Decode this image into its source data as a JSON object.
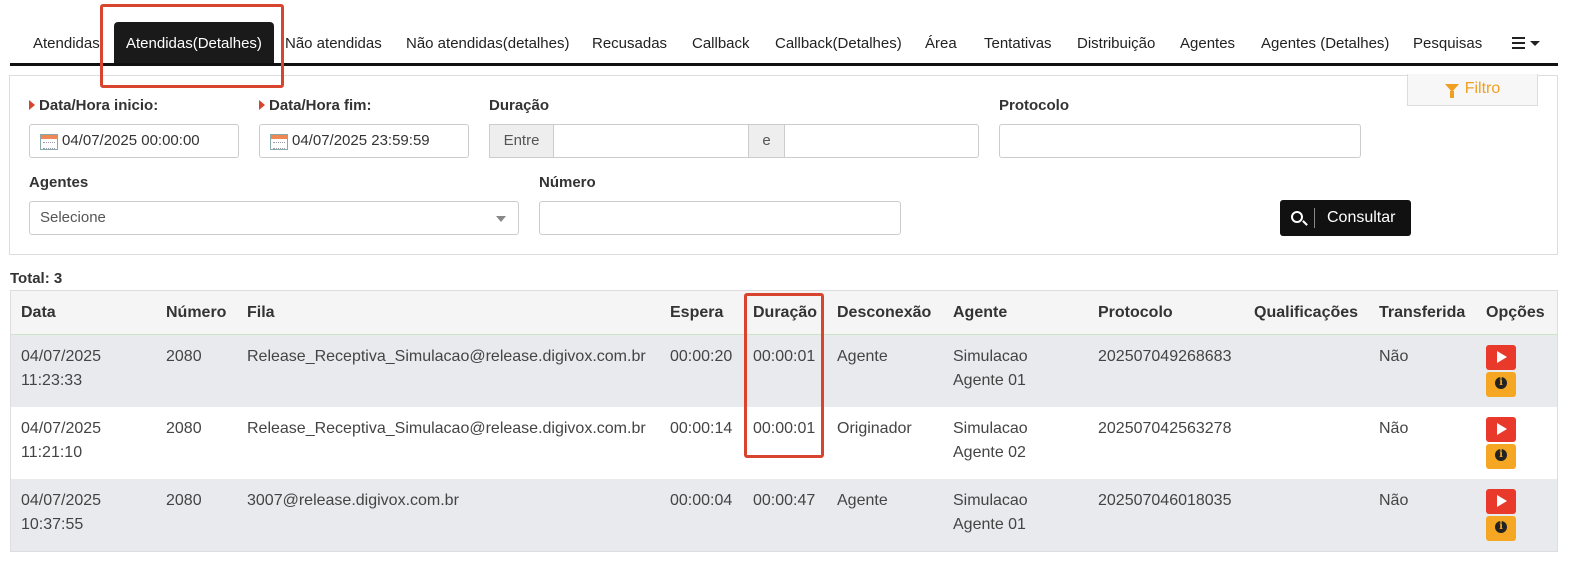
{
  "tabs": [
    {
      "label": "Atendidas"
    },
    {
      "label": "Atendidas(Detalhes)"
    },
    {
      "label": "Não atendidas"
    },
    {
      "label": "Não atendidas(detalhes)"
    },
    {
      "label": "Recusadas"
    },
    {
      "label": "Callback"
    },
    {
      "label": "Callback(Detalhes)"
    },
    {
      "label": "Área"
    },
    {
      "label": "Tentativas"
    },
    {
      "label": "Distribuição"
    },
    {
      "label": "Agentes"
    },
    {
      "label": "Agentes (Detalhes)"
    },
    {
      "label": "Pesquisas"
    }
  ],
  "active_tab": "Atendidas(Detalhes)",
  "filter": {
    "toggle_label": "Filtro",
    "start_label": "Data/Hora inicio:",
    "start_value": "04/07/2025 00:00:00",
    "end_label": "Data/Hora fim:",
    "end_value": "04/07/2025 23:59:59",
    "duration_label": "Duração",
    "duration_between": "Entre",
    "duration_and": "e",
    "duration_from": "",
    "duration_to": "",
    "protocol_label": "Protocolo",
    "protocol_value": "",
    "agents_label": "Agentes",
    "agents_selected": "Selecione",
    "number_label": "Número",
    "number_value": "",
    "submit_label": "Consultar"
  },
  "total_label": "Total: 3",
  "table": {
    "headers": [
      "Data",
      "Número",
      "Fila",
      "Espera",
      "Duração",
      "Desconexão",
      "Agente",
      "Protocolo",
      "Qualificações",
      "Transferida",
      "Opções"
    ],
    "rows": [
      {
        "date": "04/07/2025",
        "time": "11:23:33",
        "number": "2080",
        "queue": "Release_Receptiva_Simulacao@release.digivox.com.br",
        "wait": "00:00:20",
        "duration": "00:00:01",
        "disconnect": "Agente",
        "agent_line1": "Simulacao",
        "agent_line2": "Agente 01",
        "protocol": "202507049268683",
        "qualifications": "",
        "transferred": "Não"
      },
      {
        "date": "04/07/2025",
        "time": "11:21:10",
        "number": "2080",
        "queue": "Release_Receptiva_Simulacao@release.digivox.com.br",
        "wait": "00:00:14",
        "duration": "00:00:01",
        "disconnect": "Originador",
        "agent_line1": "Simulacao",
        "agent_line2": "Agente 02",
        "protocol": "202507042563278",
        "qualifications": "",
        "transferred": "Não"
      },
      {
        "date": "04/07/2025",
        "time": "10:37:55",
        "number": "2080",
        "queue": "3007@release.digivox.com.br",
        "wait": "00:00:04",
        "duration": "00:00:47",
        "disconnect": "Agente",
        "agent_line1": "Simulacao",
        "agent_line2": "Agente 01",
        "protocol": "202507046018035",
        "qualifications": "",
        "transferred": "Não"
      }
    ]
  },
  "colors": {
    "highlight": "#d9442e",
    "accent": "#f0a020",
    "play_button": "#e8392b",
    "info_button": "#f5a623"
  },
  "icons": [
    "hamburger-menu-icon",
    "calendar-icon",
    "funnel-icon",
    "search-icon",
    "play-icon",
    "info-icon"
  ]
}
